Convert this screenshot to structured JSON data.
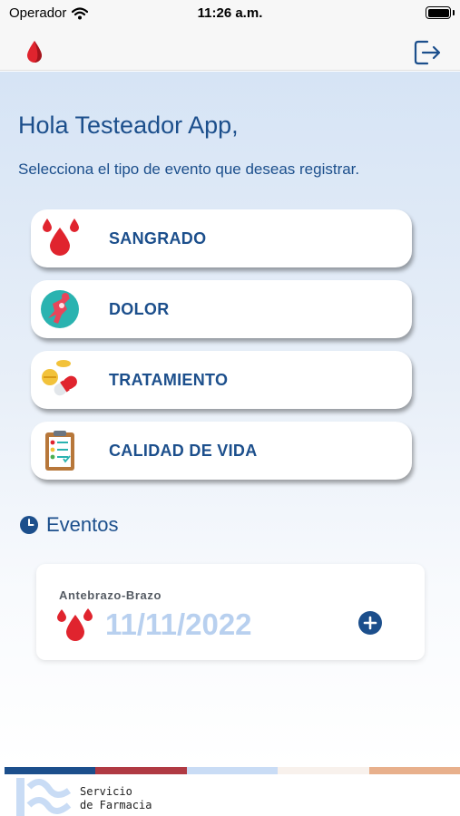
{
  "status_bar": {
    "carrier": "Operador",
    "time": "11:26 a.m.",
    "icons": [
      "wifi-icon",
      "battery-icon"
    ]
  },
  "nav_bar": {
    "logo_icon": "blood-drop-logo",
    "logout_icon": "logout-icon"
  },
  "main": {
    "greeting": "Hola Testeador App,",
    "subtitle": "Selecciona el tipo de evento que deseas registrar.",
    "event_types": [
      {
        "label": "SANGRADO",
        "icon": "blood-drops-icon"
      },
      {
        "label": "DOLOR",
        "icon": "pain-body-icon"
      },
      {
        "label": "TRATAMIENTO",
        "icon": "pills-icon"
      },
      {
        "label": "CALIDAD DE VIDA",
        "icon": "clipboard-checklist-icon"
      }
    ],
    "events_title": "Eventos",
    "events_icon": "clock-icon",
    "events": [
      {
        "location": "Antebrazo-Brazo",
        "date": "11/11/2022",
        "icon": "blood-drops-icon",
        "action_icon": "add-circle-icon"
      }
    ]
  },
  "footer": {
    "line1": "Servicio",
    "line2": "de Farmacia",
    "logo_icon": "farmacia-logo"
  },
  "colors": {
    "primary": "#1c4f8c",
    "accent_red": "#e0242e",
    "date_light": "#b8d0ef",
    "stripes": [
      "#1c4f8c",
      "#b03a43",
      "#c9dcf5",
      "#f8f1ec",
      "#e8b08c"
    ]
  }
}
